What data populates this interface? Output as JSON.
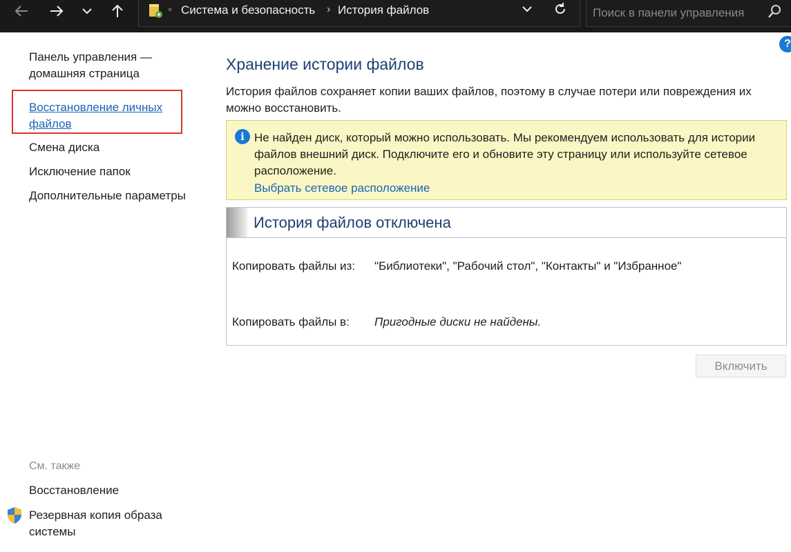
{
  "nav": {
    "back_icon": "arrow-left-icon",
    "forward_icon": "arrow-right-icon",
    "recent_icon": "chevron-down-icon",
    "up_icon": "arrow-up-icon"
  },
  "address": {
    "crumbs": [
      "Система и безопасность",
      "История файлов"
    ],
    "overflow_glyph": "«",
    "separator": "›"
  },
  "search": {
    "placeholder": "Поиск в панели управления"
  },
  "left": {
    "home": "Панель управления — домашняя страница",
    "links": [
      "Восстановление личных файлов",
      "Смена диска",
      "Исключение папок",
      "Дополнительные параметры"
    ],
    "see_also_title": "См. также",
    "see_also": [
      "Восстановление",
      "Резервная копия образа системы"
    ]
  },
  "main": {
    "title": "Хранение истории файлов",
    "description": "История файлов сохраняет копии ваших файлов, поэтому в случае потери или повреждения их можно восстановить.",
    "info": {
      "text": "Не найден диск, который можно использовать. Мы рекомендуем использовать для истории файлов внешний диск. Подключите его и обновите эту страницу или используйте сетевое расположение.",
      "link": "Выбрать сетевое расположение"
    },
    "status": {
      "title": "История файлов отключена",
      "copy_from_label": "Копировать файлы из:",
      "copy_from_value": "\"Библиотеки\", \"Рабочий стол\", \"Контакты\" и \"Избранное\"",
      "copy_to_label": "Копировать файлы в:",
      "copy_to_value": "Пригодные диски не найдены."
    },
    "enable_button": "Включить"
  },
  "colors": {
    "link": "#1a64b6",
    "title": "#1d3f72",
    "info_bg": "#fbf7c4",
    "highlight": "#d9342b"
  }
}
